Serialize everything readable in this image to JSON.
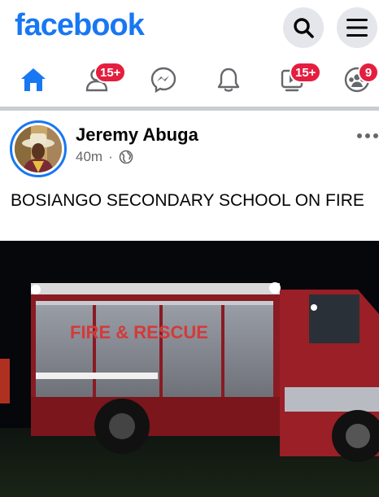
{
  "header": {
    "logo_text": "facebook",
    "brand_color": "#1877f2"
  },
  "nav": {
    "friends_badge": "15+",
    "watch_badge": "15+",
    "groups_badge": "9"
  },
  "post": {
    "author": "Jeremy Abuga",
    "time": "40m",
    "separator": "·",
    "text": "BOSIANGO SECONDARY SCHOOL ON FIRE",
    "photo_truck_text": "FIRE & RESCUE"
  },
  "icons": [
    "search-icon",
    "menu-icon",
    "home-icon",
    "friends-icon",
    "messenger-icon",
    "bell-icon",
    "watch-icon",
    "groups-icon",
    "globe-icon",
    "more-icon"
  ]
}
